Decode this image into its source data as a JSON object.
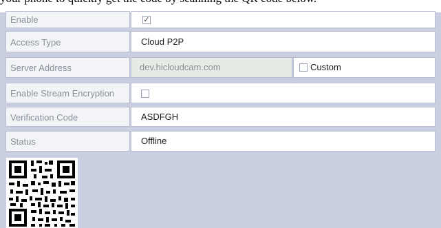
{
  "banner": {
    "text": "your phone to quickly get the code by scanning the QR code below."
  },
  "form": {
    "enable": {
      "label": "Enable",
      "checked": true,
      "mark": "✓"
    },
    "access_type": {
      "label": "Access Type",
      "value": "Cloud P2P"
    },
    "server_address": {
      "label": "Server Address",
      "value": "dev.hicloudcam.com",
      "custom_label": "Custom",
      "custom_checked": false
    },
    "stream_encryption": {
      "label": "Enable Stream Encryption",
      "checked": false
    },
    "verification_code": {
      "label": "Verification Code",
      "value": "ASDFGH"
    },
    "status": {
      "label": "Status",
      "value": "Offline"
    }
  },
  "colors": {
    "background": "#c9cfe1",
    "label_bg": "#f2f4f8",
    "disabled_bg": "#e7ebe5",
    "border": "#b8bfd2"
  },
  "qr": {
    "icon": "qr-code-icon"
  }
}
